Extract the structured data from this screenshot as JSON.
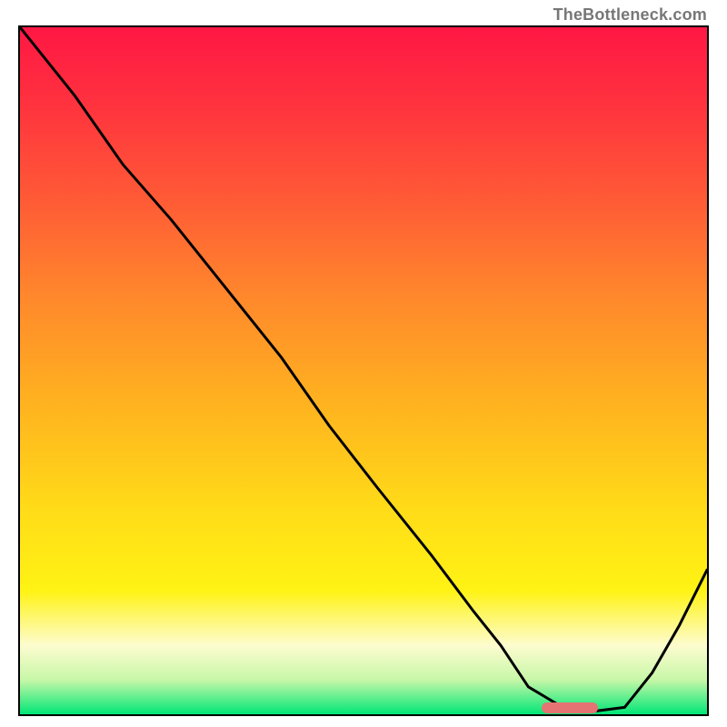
{
  "attribution": "TheBottleneck.com",
  "colors": {
    "curve": "#000000",
    "marker": "#e57373",
    "gradient_stops": [
      {
        "offset": 0.0,
        "color": "#ff1744"
      },
      {
        "offset": 0.1,
        "color": "#ff2f3f"
      },
      {
        "offset": 0.25,
        "color": "#ff5a36"
      },
      {
        "offset": 0.4,
        "color": "#ff8a2b"
      },
      {
        "offset": 0.55,
        "color": "#ffb31f"
      },
      {
        "offset": 0.7,
        "color": "#ffdb18"
      },
      {
        "offset": 0.82,
        "color": "#fff314"
      },
      {
        "offset": 0.9,
        "color": "#fdfccf"
      },
      {
        "offset": 0.95,
        "color": "#c7f7a8"
      },
      {
        "offset": 1.0,
        "color": "#00e676"
      }
    ]
  },
  "chart_data": {
    "type": "line",
    "title": "",
    "xlabel": "",
    "ylabel": "",
    "xlim": [
      0,
      100
    ],
    "ylim": [
      0,
      100
    ],
    "x": [
      0,
      8,
      15,
      22,
      30,
      38,
      45,
      52,
      60,
      66,
      70,
      74,
      79,
      84,
      88,
      92,
      96,
      100
    ],
    "y": [
      100,
      90,
      80,
      72,
      62,
      52,
      42,
      33,
      23,
      15,
      10,
      4,
      1,
      0.5,
      1,
      6,
      13,
      21
    ],
    "series": [],
    "marker": {
      "x": 80,
      "y": 0.9
    },
    "grid": false,
    "legend": false
  }
}
